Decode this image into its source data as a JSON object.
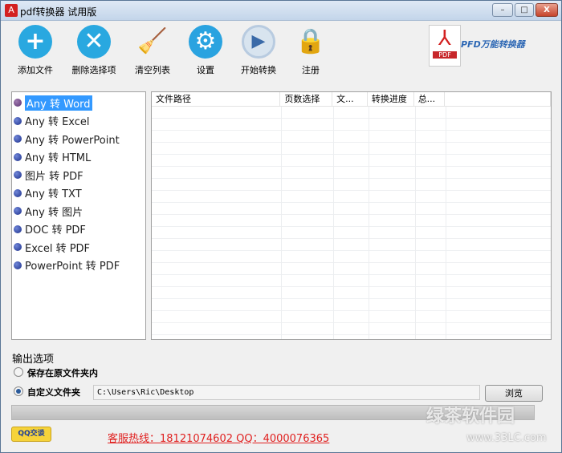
{
  "window": {
    "title": "pdf转换器 试用版",
    "minimize": "–",
    "maximize": "□",
    "close": "X"
  },
  "toolbar": [
    {
      "label": "添加文件",
      "glyph": "+",
      "color": "#29a8e0"
    },
    {
      "label": "删除选择项",
      "glyph": "✕",
      "color": "#29a8e0"
    },
    {
      "label": "清空列表",
      "glyph": "🧹",
      "color": "transparent"
    },
    {
      "label": "设置",
      "glyph": "⚙",
      "color": "#2aa3e0"
    },
    {
      "label": "开始转换",
      "glyph": "▶",
      "color": "#d8e4ef"
    },
    {
      "label": "注册",
      "glyph": "🔒",
      "color": "transparent"
    }
  ],
  "logo": {
    "text": "PFD万能转换器",
    "badge": "PDF"
  },
  "conversions": [
    "Any 转 Word",
    "Any 转 Excel",
    "Any 转 PowerPoint",
    "Any 转 HTML",
    "图片 转 PDF",
    "Any 转 TXT",
    "Any 转 图片",
    "DOC 转 PDF",
    "Excel 转 PDF",
    "PowerPoint 转 PDF"
  ],
  "table": {
    "columns": [
      "文件路径",
      "页数选择",
      "文...",
      "转换进度",
      "总..."
    ]
  },
  "output": {
    "title": "输出选项",
    "option_original": "保存在原文件夹内",
    "option_custom": "自定义文件夹",
    "path": "C:\\Users\\Ric\\Desktop",
    "browse": "浏览"
  },
  "footer": {
    "qq_button": "QQ交谈",
    "hotline": "客服热线：18121074602 QQ：4000076365"
  },
  "watermark": {
    "name": "绿茶软件园",
    "url": "www.33LC.com"
  }
}
